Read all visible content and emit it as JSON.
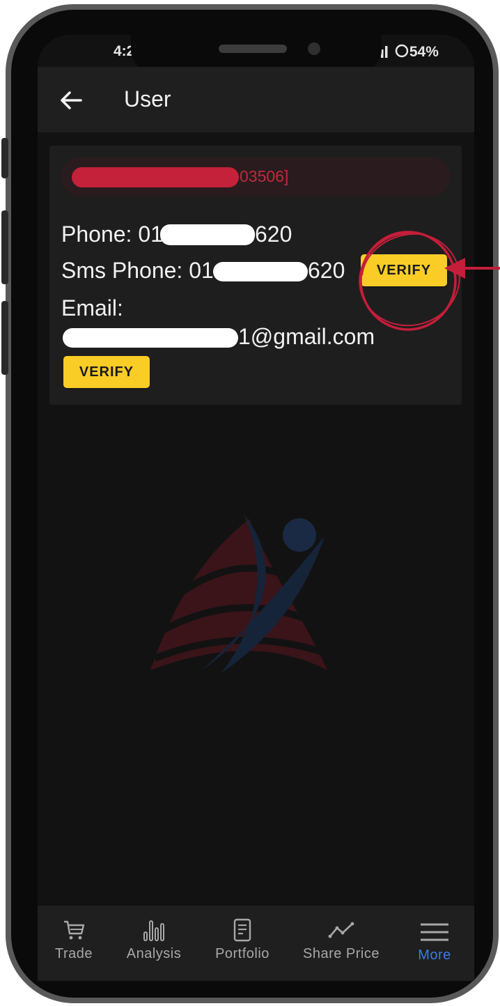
{
  "status_bar": {
    "time": "4:2",
    "battery": "54%"
  },
  "header": {
    "title": "User"
  },
  "user_card": {
    "id_suffix": "03506]",
    "phone_prefix": "Phone: 01",
    "phone_suffix": "620",
    "sms_prefix": "Sms Phone: 01",
    "sms_suffix": "620",
    "sms_verify_label": "VERIFY",
    "email_label": "Email:",
    "email_suffix": "1@gmail.com",
    "email_verify_label": "VERIFY"
  },
  "bottom_nav": {
    "items": [
      {
        "label": "Trade",
        "icon": "cart-icon"
      },
      {
        "label": "Analysis",
        "icon": "bar-chart-icon"
      },
      {
        "label": "Portfolio",
        "icon": "document-icon"
      },
      {
        "label": "Share Price",
        "icon": "trend-line-icon"
      },
      {
        "label": "More",
        "icon": "menu-icon",
        "active": true
      }
    ]
  },
  "colors": {
    "accent_yellow": "#f9cd26",
    "active_nav": "#3d7be0",
    "annotation_red": "#c41e3a",
    "background": "#121212"
  }
}
